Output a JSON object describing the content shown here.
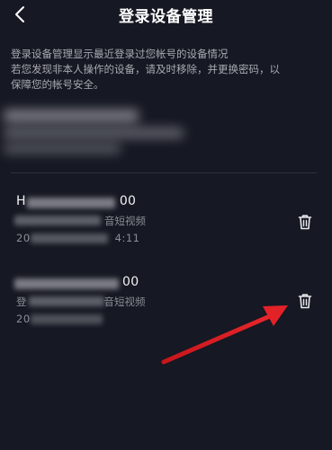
{
  "header": {
    "title": "登录设备管理",
    "back_icon": "chevron-left-icon"
  },
  "description": {
    "line1": "登录设备管理显示最近登录过您帐号的设备情况",
    "line2": "若您发现非本人操作的设备，请及时移除，并更换密码，以",
    "line3": "保障您的帐号安全。"
  },
  "devices": [
    {
      "name_prefix": "H",
      "name_suffix": "00",
      "app_suffix": "音短视频",
      "time_prefix": "20",
      "time_suffix": "4:11",
      "delete_icon": "trash-icon"
    },
    {
      "name_suffix": "00",
      "app_prefix": "登",
      "app_suffix": "音短视频",
      "time_prefix": "20",
      "delete_icon": "trash-icon"
    }
  ],
  "colors": {
    "background": "#161823",
    "title": "#ffffff",
    "secondary_text": "#8a8c95",
    "annotation": "#e32227"
  }
}
